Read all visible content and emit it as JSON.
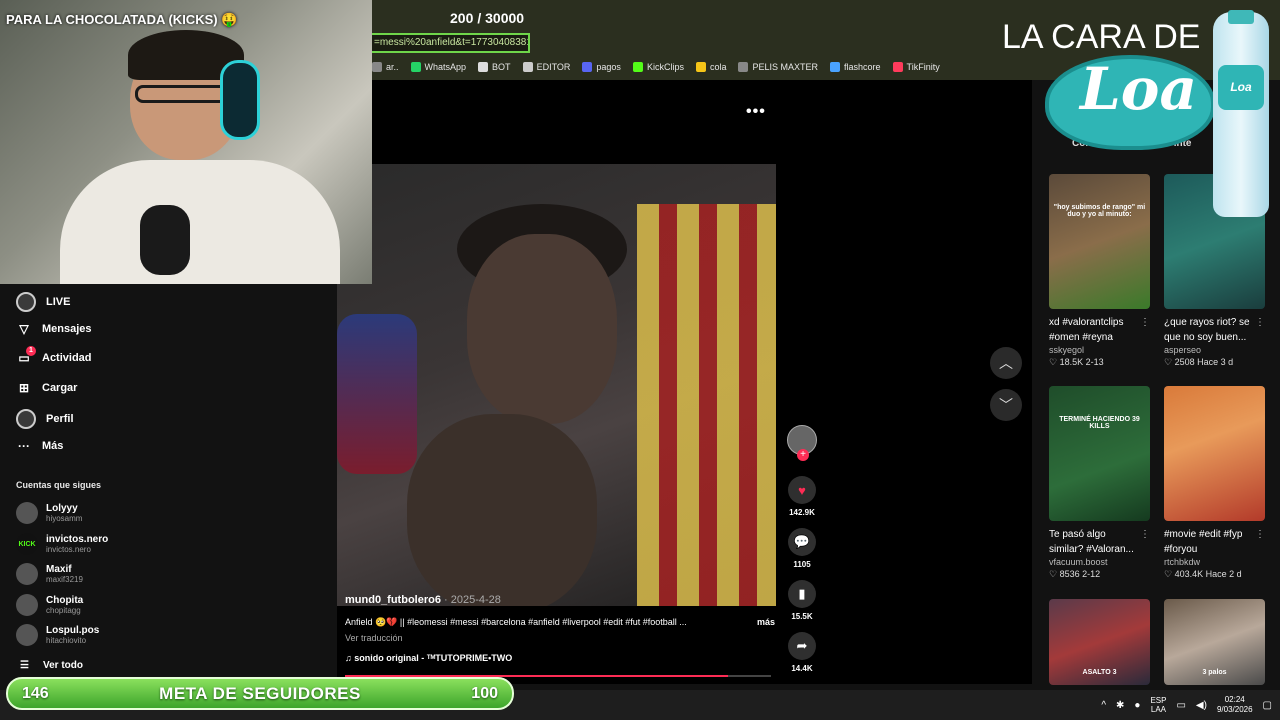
{
  "stream": {
    "title": "PARA LA CHOCOLATADA (KICKS) 🤑",
    "counter_current": "200",
    "counter_total": "/ 30000"
  },
  "browser": {
    "url": "=messi%20anfield&t=1773040838126",
    "bookmarks": [
      {
        "label": "ar..",
        "icon": "folder-icon",
        "color": "#888888"
      },
      {
        "label": "WhatsApp",
        "icon": "whatsapp-icon",
        "color": "#25d366"
      },
      {
        "label": "BOT",
        "icon": "bot-icon",
        "color": "#dddddd"
      },
      {
        "label": "EDITOR",
        "icon": "globe-icon",
        "color": "#cccccc"
      },
      {
        "label": "pagos",
        "icon": "pagos-icon",
        "color": "#5865f2"
      },
      {
        "label": "KickClips",
        "icon": "kick-icon",
        "color": "#53fc18"
      },
      {
        "label": "cola",
        "icon": "cola-icon",
        "color": "#f5c518"
      },
      {
        "label": "PELIS MAXTER",
        "icon": "pelis-icon",
        "color": "#888888"
      },
      {
        "label": "flashcore",
        "icon": "flashcore-icon",
        "color": "#4aa3ff"
      },
      {
        "label": "TikFinity",
        "icon": "tikfinity-icon",
        "color": "#ff3b5c"
      }
    ]
  },
  "sidebar": {
    "nav": [
      {
        "label": "LIVE",
        "icon": "live-icon"
      },
      {
        "label": "Mensajes",
        "icon": "messages-icon"
      },
      {
        "label": "Actividad",
        "icon": "activity-icon",
        "badge": "1"
      },
      {
        "label": "Cargar",
        "icon": "upload-icon"
      },
      {
        "label": "Perfil",
        "icon": "profile-icon"
      },
      {
        "label": "Más",
        "icon": "more-icon"
      }
    ],
    "following_header": "Cuentas que sigues",
    "following": [
      {
        "name": "Lolyyy",
        "user": "hiyosamm"
      },
      {
        "name": "invictos.nero",
        "user": "invictos.nero",
        "tag": "KICK"
      },
      {
        "name": "Maxif",
        "user": "maxif3219"
      },
      {
        "name": "Chopita",
        "user": "chopitagg"
      },
      {
        "name": "Lospul.pos",
        "user": "hitachiovito"
      }
    ],
    "see_all": "Ver todo"
  },
  "video": {
    "author": "mund0_futbolero6",
    "date": "· 2025-4-28",
    "caption": "Anfield 🥺💔 || #leomessi #messi #barcelona #anfield #liverpool #edit #fut #football ...",
    "more": "más",
    "translate": "Ver traducción",
    "sound": "♫ sonido original - ᵀᴹTUTOPRIME•TWO",
    "progress": 0.9,
    "likes": "142.9K",
    "comments": "1105",
    "saves": "15.5K",
    "shares": "14.4K",
    "accent": "#fe2c55"
  },
  "right_panel": {
    "tabs": [
      "Come",
      "Podría inte"
    ],
    "cards": [
      {
        "desc": "xd #valorantclips #omen #reyna",
        "user": "sskyegol",
        "likes": "18.5K",
        "date": "2-13",
        "thumb_text": "\"hoy subimos de rango\" mi duo y yo al minuto:"
      },
      {
        "desc": "¿que rayos riot? se que no soy buen...",
        "user": "asperseo",
        "likes": "2508",
        "date": "Hace 3 d",
        "thumb_text": ""
      },
      {
        "desc": "Te pasó algo similar? #Valoran...",
        "user": "vfacuum.boost",
        "likes": "8536",
        "date": "2-12",
        "thumb_text": "TERMINÉ HACIENDO 39 KILLS"
      },
      {
        "desc": "#movie #edit #fyp #foryou",
        "user": "rtchbkdw",
        "likes": "403.4K",
        "date": "Hace 2 d",
        "thumb_text": ""
      },
      {
        "desc": "",
        "user": "",
        "likes": "",
        "date": "",
        "thumb_text": "ASALTO 3"
      },
      {
        "desc": "",
        "user": "",
        "likes": "",
        "date": "",
        "thumb_text": "3 palos"
      }
    ]
  },
  "brand": {
    "headline": "LA CARA DE",
    "logo": "Loa"
  },
  "goal": {
    "current": "146",
    "label": "META DE SEGUIDORES",
    "target": "100"
  },
  "taskbar": {
    "lang_1": "ESP",
    "lang_2": "LAA",
    "time": "02:24",
    "date": "9/03/2026"
  }
}
